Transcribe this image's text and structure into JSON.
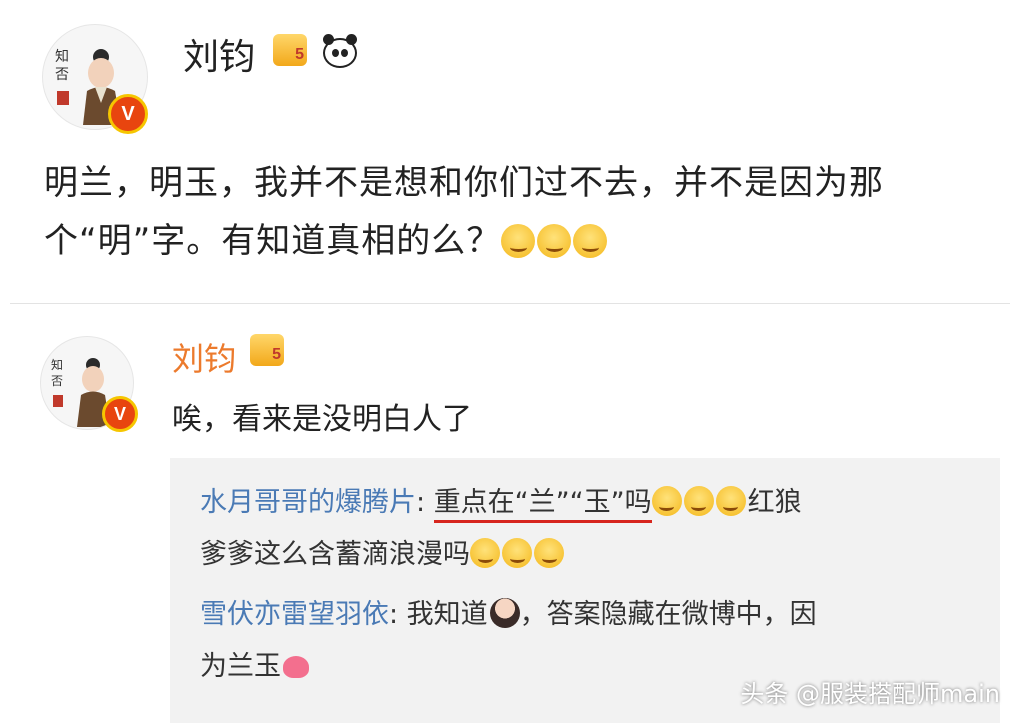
{
  "post": {
    "author": "刘钧",
    "text_line1": "明兰，明玉，我并不是想和你们过不去，并不是因为那",
    "text_line2": "个“明”字。有知道真相的么？"
  },
  "reply": {
    "author": "刘钧",
    "text": "唉，看来是没明白人了"
  },
  "quoted": [
    {
      "user": "水月哥哥的爆腾片",
      "line1_a": ": ",
      "line1_underlined": "重点在“兰”“玉”吗",
      "line1_b": "红狼",
      "line2": "爹爹这么含蓄滴浪漫吗"
    },
    {
      "user": "雪伏亦雷望羽依",
      "line1": ": 我知道",
      "line1_b": "，答案隐藏在微博中，因",
      "line2": "为兰玉"
    }
  ],
  "badges": {
    "verified": "V",
    "crown_level": "5"
  },
  "watermark": "头条 @服装搭配师main",
  "icons": [
    "verified-badge-icon",
    "crown-level-icon",
    "panda-icon",
    "smile-emoji-icon",
    "girl-emoji-icon",
    "heart-emoji-icon"
  ]
}
